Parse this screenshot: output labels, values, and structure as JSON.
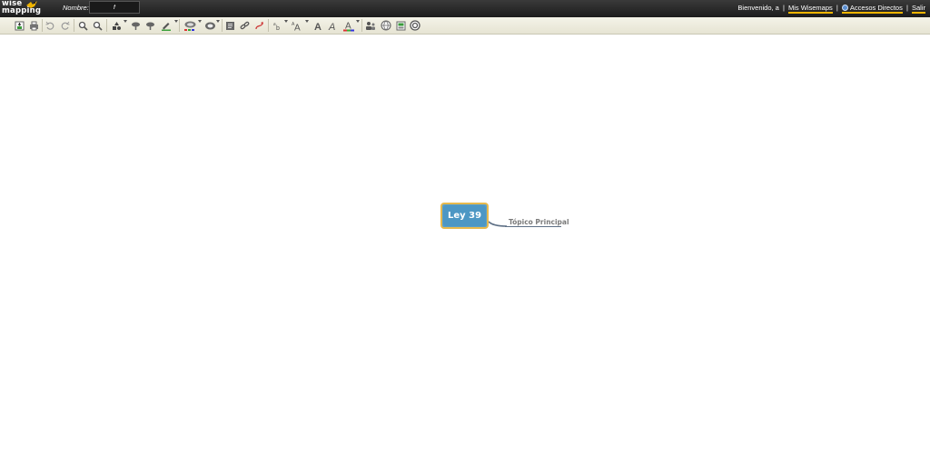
{
  "header": {
    "logo_text_top": "wise",
    "logo_text_bottom": "mapping",
    "name_label": "Nombre:",
    "name_value": "f",
    "welcome_text": "Bienvenido, a",
    "my_maps_link": "Mis Wisemaps",
    "shortcuts_link": "Accesos Directos",
    "logout_link": "Salir",
    "separator": "|"
  },
  "toolbar": {
    "icons": [
      "export-icon",
      "print-icon",
      "undo-icon",
      "redo-icon",
      "zoom-in-icon",
      "zoom-out-icon",
      "topic-shape-icon",
      "add-topic-icon",
      "delete-topic-icon",
      "border-color-icon",
      "background-color-icon",
      "icon-picker-icon",
      "note-icon",
      "link-icon",
      "relationship-icon",
      "font-type-icon",
      "font-size-icon",
      "font-bold-icon",
      "font-italic-icon",
      "font-color-icon",
      "share-icon",
      "publish-icon",
      "history-icon",
      "help-icon"
    ]
  },
  "mindmap": {
    "central_topic": "Ley 39",
    "subtopic": "Tópico Principal"
  },
  "colors": {
    "accent": "#f0b400",
    "central_fill": "#4d97c4",
    "central_border": "#e7b94d",
    "topic_line": "#5e7086"
  }
}
